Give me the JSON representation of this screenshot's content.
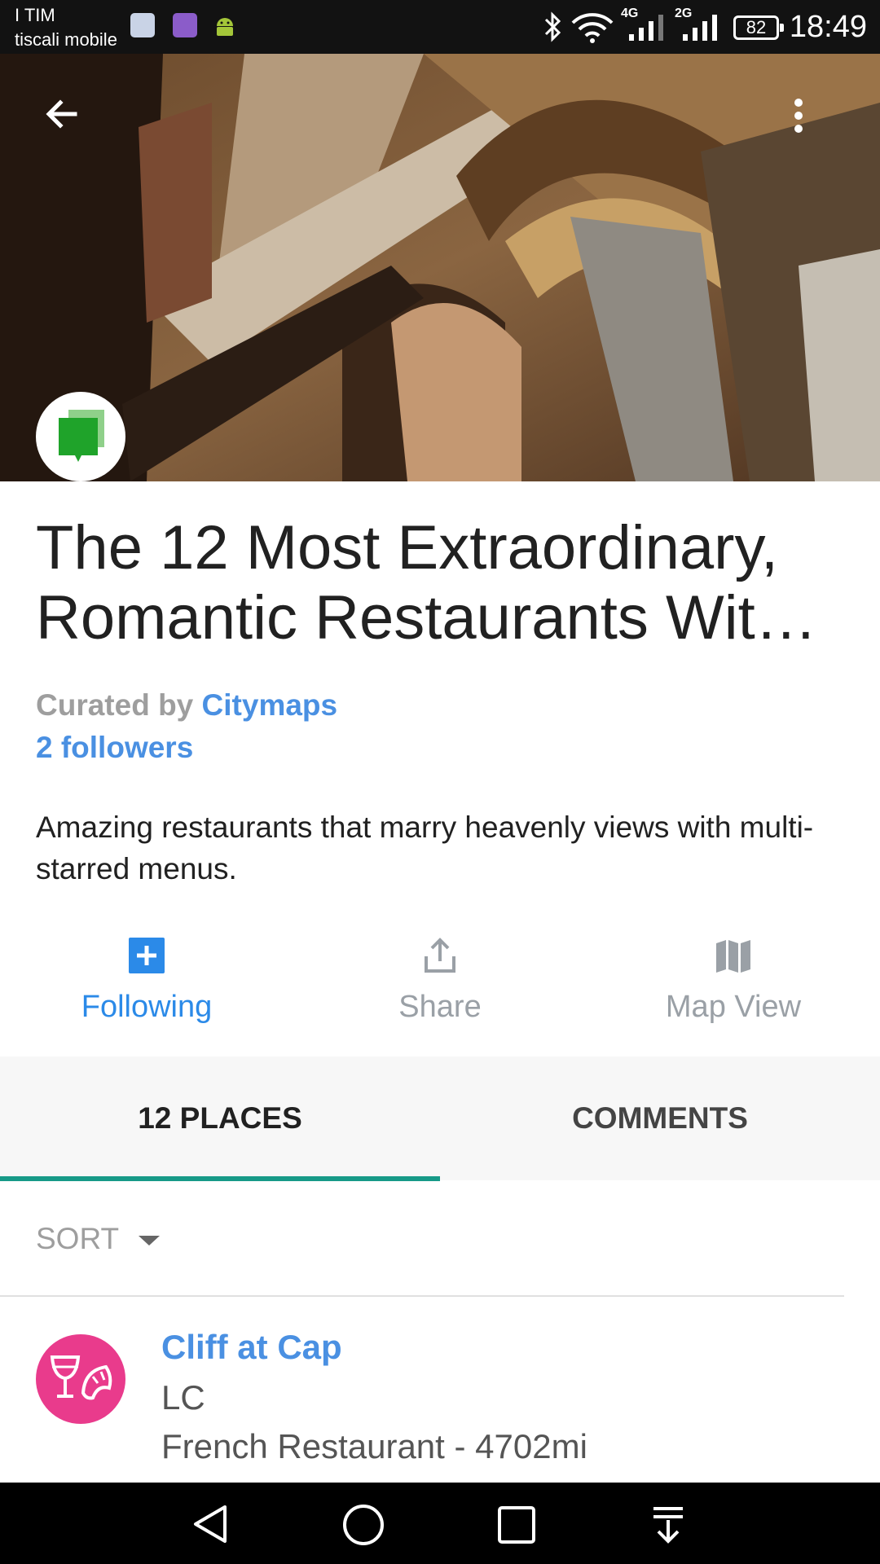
{
  "status_bar": {
    "carrier_line1": "I TIM",
    "carrier_line2": "tiscali mobile",
    "network_4g": "4G",
    "network_2g": "2G",
    "battery": "82",
    "time": "18:49"
  },
  "hero": {
    "back_icon": "arrow-left-icon",
    "menu_icon": "more-vert-icon",
    "avatar_icon": "speech-bubble-icon"
  },
  "list": {
    "title_line1": "The 12 Most Extraordinary,",
    "title_line2": "Romantic Restaurants With …",
    "curated_prefix": "Curated by",
    "curator": "Citymaps",
    "followers": "2 followers",
    "description": "Amazing restaurants that marry heavenly views with multi-starred menus."
  },
  "actions": {
    "following": "Following",
    "share": "Share",
    "map_view": "Map View"
  },
  "tabs": {
    "places": "12 PLACES",
    "comments": "COMMENTS",
    "active": "places",
    "indicator_color": "#179a88"
  },
  "sort": {
    "label": "SORT"
  },
  "places": [
    {
      "name": "Cliff at Cap",
      "subtitle": "LC",
      "meta": "French Restaurant - 4702mi",
      "icon": "wine-croissant-icon",
      "icon_color": "#e93b8c"
    }
  ],
  "colors": {
    "link": "#4a90e2",
    "accent_blue": "#2b8ae8"
  }
}
